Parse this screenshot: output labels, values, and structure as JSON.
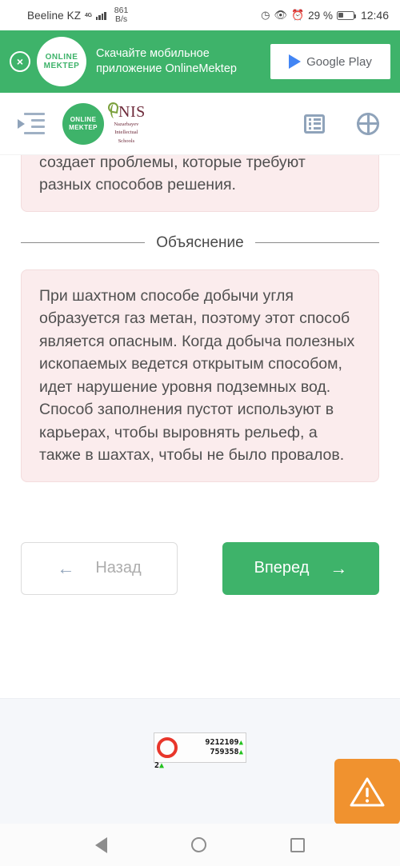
{
  "status_bar": {
    "carrier": "Beeline KZ",
    "network_type": "4G",
    "data_speed_value": "861",
    "data_speed_unit": "B/s",
    "icons": [
      "history-icon",
      "eye-care-icon",
      "alarm-clock-icon"
    ],
    "battery_percent": "29 %",
    "time": "12:46"
  },
  "ad_banner": {
    "close_label": "×",
    "logo_line1": "ONLINE",
    "logo_line2": "MEKTEP",
    "text": "Скачайте мобильное приложение OnlineMektep",
    "store_button_label": "Google Play",
    "background_color": "#3eb36a"
  },
  "app_header": {
    "menu_icon": "expand-sidebar-icon",
    "brand_logo_line1": "ONLINE",
    "brand_logo_line2": "MEKTEP",
    "partner_logo_word": "NIS",
    "partner_logo_sub_line1": "Nazarbayev",
    "partner_logo_sub_line2": "Intellectual",
    "partner_logo_sub_line3": "Schools",
    "list_icon": "list-view-icon",
    "globe_icon": "language-globe-icon"
  },
  "content": {
    "question_card_text": "создает проблемы, которые требуют разных способов решения.",
    "divider_label": "Объяснение",
    "explanation_text": "При шахтном способе добычи угля образуется газ метан, поэтому этот способ является опасным. Когда добыча полезных ископаемых ведется открытым способом, идет нарушение уровня подземных вод. Способ заполнения пустот используют в карьерах, чтобы выровнять рельеф, а также в шахтах, чтобы не было провалов."
  },
  "navigation": {
    "back_label": "Назад",
    "back_arrow": "←",
    "forward_label": "Вперед",
    "forward_arrow": "→",
    "forward_color": "#3eb36a"
  },
  "bottom_ad": {
    "counter_value_top": "9212109",
    "counter_value_bottom": "759358",
    "counter_value_corner": "2",
    "marker_triangle": "▲",
    "ring_color": "#e8362b",
    "triangle_color": "#23c11e",
    "warning_icon": "warning-triangle-icon",
    "warning_color": "#f0922f"
  },
  "android_nav": {
    "back_icon": "nav-back-icon",
    "home_icon": "nav-home-icon",
    "recents_icon": "nav-recents-icon"
  }
}
